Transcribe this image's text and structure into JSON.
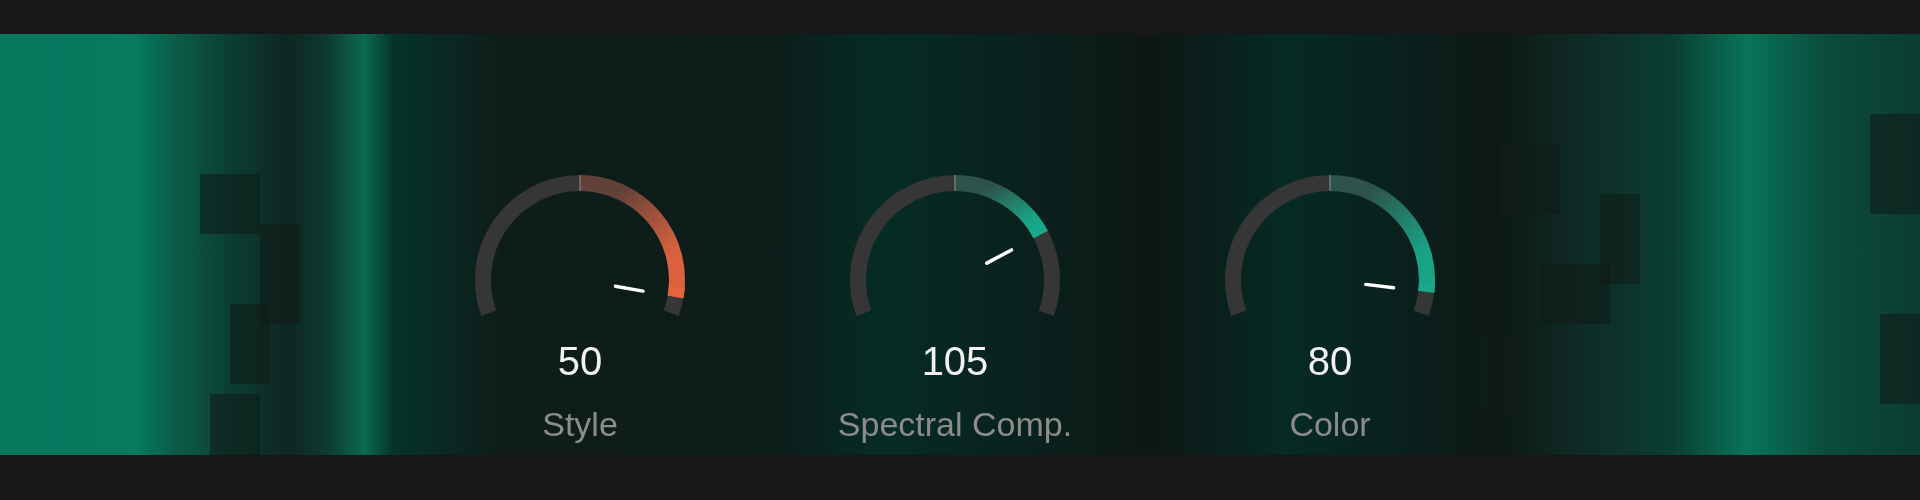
{
  "knobs": [
    {
      "value": "50",
      "label": "Style",
      "color": "#e4643f"
    },
    {
      "value": "105",
      "label": "Spectral Comp.",
      "color": "#17a98a"
    },
    {
      "value": "80",
      "label": "Color",
      "color": "#17a98a"
    }
  ]
}
